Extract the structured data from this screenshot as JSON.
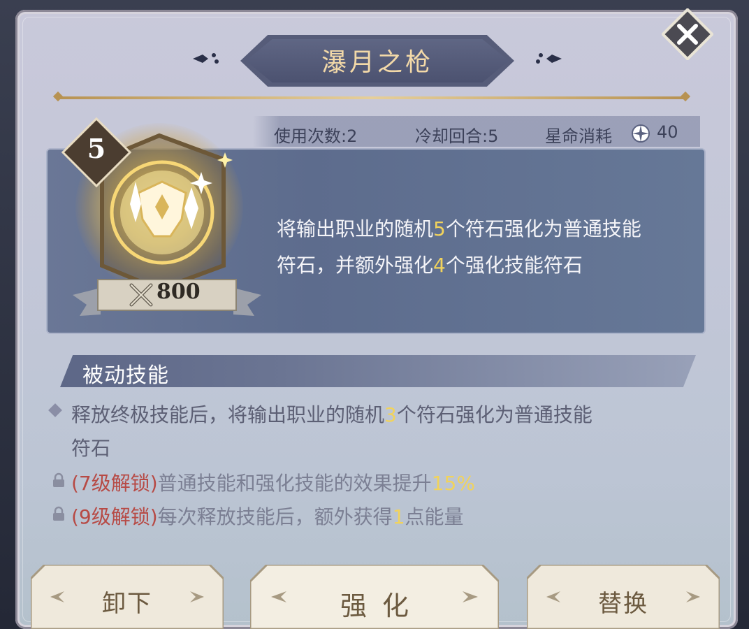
{
  "dialog": {
    "title": "瀑月之枪",
    "close_icon": "close-x-icon"
  },
  "stats": {
    "uses_label": "使用次数:2",
    "cooldown_label": "冷却回合:5",
    "cost_label": "星命消耗",
    "cost_value": "40",
    "cost_icon": "star-compass-icon"
  },
  "skill": {
    "level": "5",
    "power_cost": "800",
    "power_icon": "crossed-swords-icon",
    "emblem_icon": "rune-shield-icon",
    "desc_parts": [
      "将输出职业的随机",
      "5",
      "个符石强化为普通技能",
      "符石，并额外强化",
      "4",
      "个强化技能符石"
    ]
  },
  "passive": {
    "header": "被动技能",
    "line1_parts": [
      "释放终极技能后，将输出职业的随机",
      "3",
      "个符石强化为普通技能"
    ],
    "line1_cont": "符石",
    "unlock1": {
      "tag": "(7级解锁)",
      "text": "普通技能和强化技能的效果提升",
      "value": "15%"
    },
    "unlock2": {
      "tag": "(9级解锁)",
      "text_a": "每次释放技能后，额外获得",
      "value": "1",
      "text_b": "点能量"
    }
  },
  "buttons": {
    "unequip": "卸下",
    "enhance": "强化",
    "replace": "替换"
  },
  "colors": {
    "highlight": "#f1d35c",
    "unlock_tag": "#b74a45",
    "title_gold": "#f3d9a8"
  }
}
